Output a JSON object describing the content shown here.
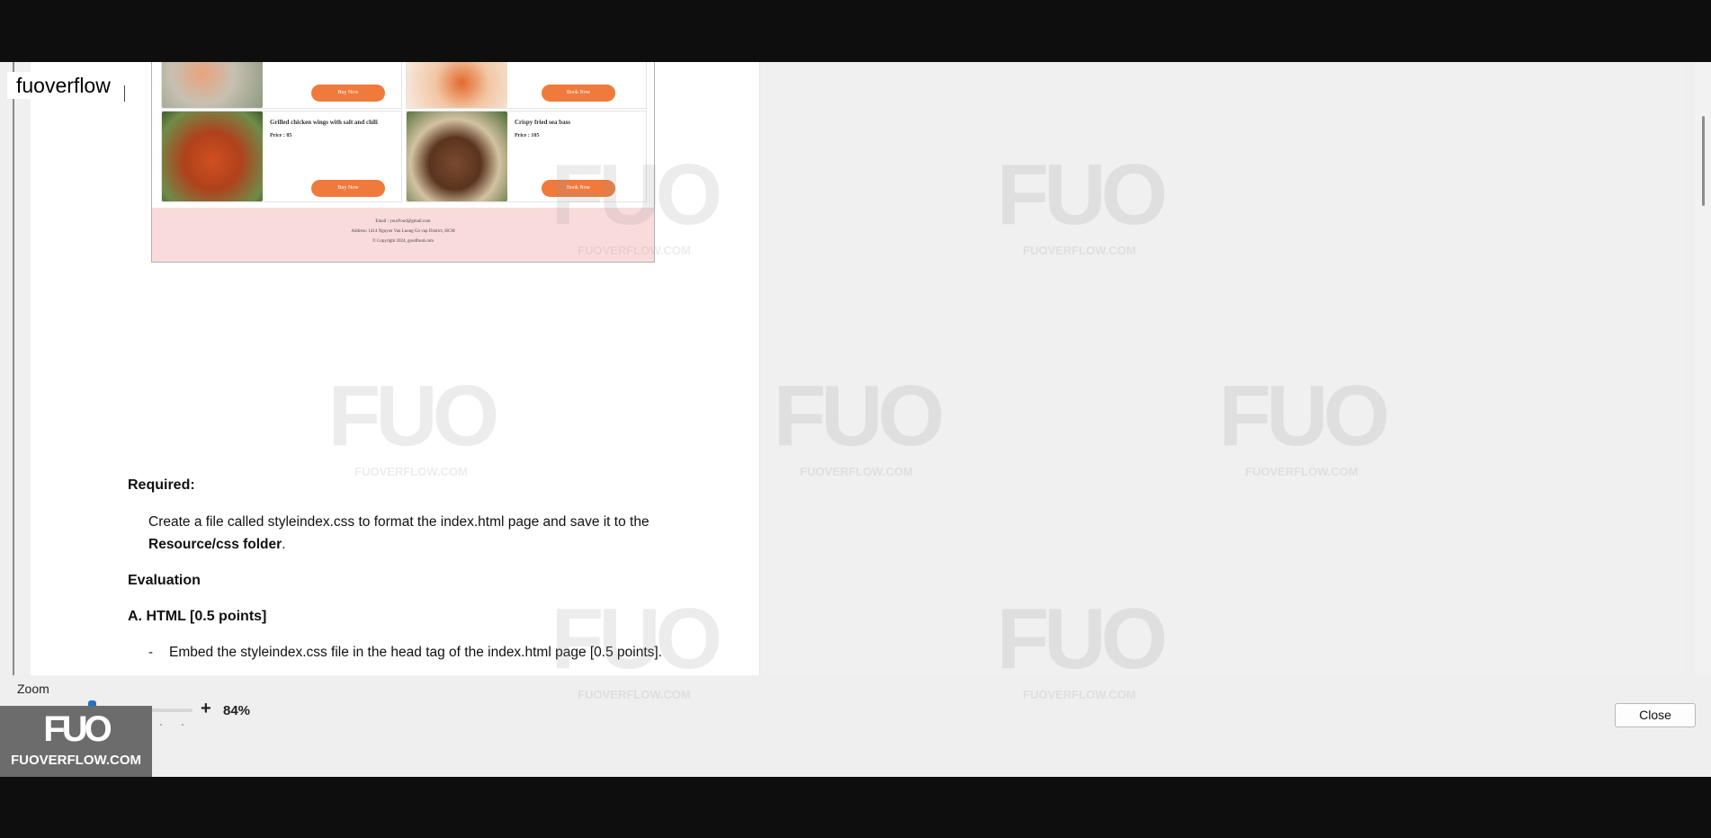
{
  "app": {
    "label": "fuoverflow"
  },
  "screenshot": {
    "items": [
      {
        "name": "",
        "price": "",
        "button": "Buy Now"
      },
      {
        "name": "",
        "price": "",
        "button": "Book Now"
      },
      {
        "name": "Grilled chicken wings with salt and chili",
        "price": "Price : 85",
        "button": "Buy Now"
      },
      {
        "name": "Crispy fried sea bass",
        "price": "Price : 105",
        "button": "Book Now"
      }
    ],
    "footer": {
      "email": "Email : yourFood@gmail.com",
      "address": "Address: 1414 Nguyen Van Luong Go vap District, HCM",
      "copyright": "© Copyright 2024, goodfood.com"
    }
  },
  "document": {
    "required_heading": "Required:",
    "required_text_line1": "Create a file called styleindex.css to format the index.html page and save it to the",
    "required_text_bold": "Resource/css folder",
    "required_text_end": ".",
    "evaluation_heading": "Evaluation",
    "section_heading": "A. HTML  [0.5 points]",
    "bullet_dash": "-",
    "bullet_text": "Embed the styleindex.css file in the head tag of the index.html page [0.5 points]."
  },
  "zoom": {
    "label": "Zoom",
    "minus": "-",
    "plus": "+",
    "value": "84%",
    "level": 0.35
  },
  "close_button": {
    "label": "Close"
  },
  "branding": {
    "logo": "FUO",
    "site": "FUOVERFLOW.COM"
  },
  "watermark": {
    "logo": "FUO",
    "site": "FUOVERFLOW.COM"
  },
  "colors": {
    "button_orange": "#f07a3b",
    "footer_pink": "#fadbdb",
    "zoom_thumb": "#1f74c7"
  }
}
